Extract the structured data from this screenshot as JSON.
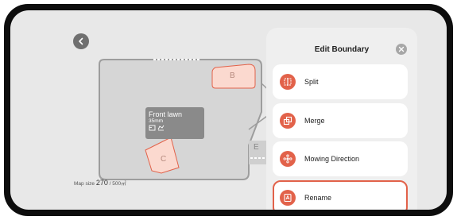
{
  "map": {
    "zones": [
      {
        "label": "B"
      },
      {
        "label": "C"
      },
      {
        "label": "E"
      }
    ],
    "lawn_card": {
      "name": "Front lawn",
      "height": "35mm",
      "icons": [
        "lawn-icon",
        "mower-icon"
      ]
    },
    "map_size": {
      "prefix": "Map size",
      "value": "270",
      "total": "/ 500㎡"
    }
  },
  "panel": {
    "title": "Edit Boundary",
    "items": [
      {
        "label": "Split",
        "icon": "split-icon"
      },
      {
        "label": "Merge",
        "icon": "merge-icon"
      },
      {
        "label": "Mowing Direction",
        "icon": "mowing-direction-icon"
      },
      {
        "label": "Rename",
        "icon": "rename-icon",
        "selected": true
      }
    ]
  },
  "colors": {
    "accent": "#e2624a",
    "zone_fill": "#fbd9cf",
    "map_area": "#d6d6d6",
    "background": "#e8e8e8"
  }
}
